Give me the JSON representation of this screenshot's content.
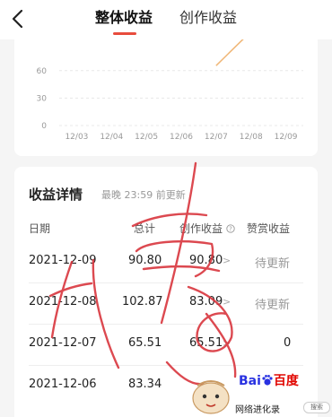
{
  "header": {
    "tabs": [
      {
        "label": "整体收益",
        "active": true
      },
      {
        "label": "创作收益",
        "active": false
      }
    ]
  },
  "chart_data": {
    "type": "line",
    "x": [
      "12/03",
      "12/04",
      "12/05",
      "12/06",
      "12/07",
      "12/08",
      "12/09"
    ],
    "yticks": [
      0,
      30,
      60
    ],
    "ylim": [
      0,
      100
    ],
    "series": [
      {
        "values": [
          null,
          null,
          null,
          null,
          65.51,
          102.87,
          null
        ],
        "color": "#f0b87a"
      }
    ]
  },
  "detail": {
    "title": "收益详情",
    "update_note": "最晚 23:59 前更新",
    "columns": {
      "date": "日期",
      "total": "总计",
      "creation": "创作收益",
      "reward": "赞赏收益"
    },
    "rows": [
      {
        "date": "2021-12-09",
        "total": "90.80",
        "creation": "90.80",
        "reward": "待更新"
      },
      {
        "date": "2021-12-08",
        "total": "102.87",
        "creation": "83.09",
        "reward": "待更新"
      },
      {
        "date": "2021-12-07",
        "total": "65.51",
        "creation": "65.51",
        "reward": "0"
      },
      {
        "date": "2021-12-06",
        "total": "83.34",
        "creation": "",
        "reward": ""
      }
    ]
  },
  "watermark": {
    "logo_bai": "Bai",
    "logo_du": "百度",
    "name": "网络进化录",
    "search": "搜索"
  },
  "colors": {
    "accent": "#e84c3d",
    "line": "#f0b87a",
    "scribble": "#d9363e"
  }
}
